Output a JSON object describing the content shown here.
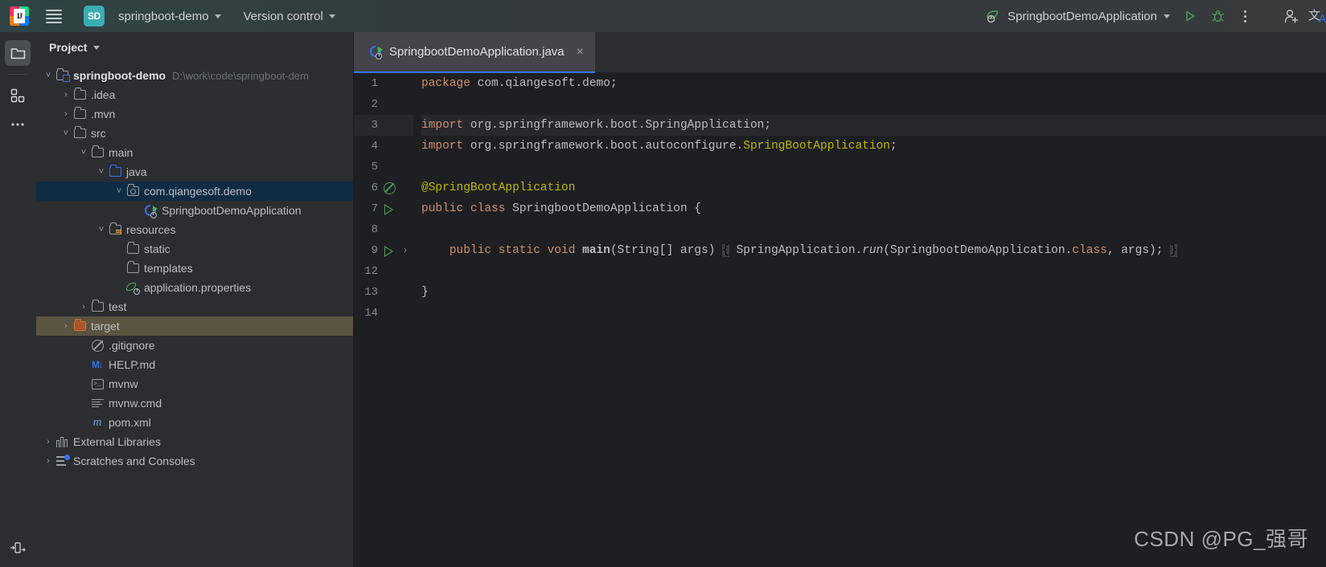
{
  "titlebar": {
    "app_icon": "intellij-idea-logo",
    "menu_icon": "hamburger-menu-icon",
    "project_badge": "SD",
    "project_name": "springboot-demo",
    "version_control": "Version control",
    "run_config": "SpringbootDemoApplication",
    "run_icon": "run-play-icon",
    "debug_icon": "debug-bug-icon",
    "more_icon": "more-actions-kebab-icon",
    "account_icon": "add-account-icon",
    "translate_icon": "translate-icon"
  },
  "rail": {
    "project_icon": "project-folder-icon",
    "structure_icon": "structure-icon",
    "more_icon": "more-tool-windows-icon",
    "bottom_icon": "layout-settings-icon"
  },
  "project_panel": {
    "title": "Project",
    "title_chevron": "chevron-down-icon",
    "tree": [
      {
        "label": "springboot-demo",
        "sublabel": "D:\\work\\code\\springboot-dem",
        "icon": "module-folder-icon",
        "indent": 0,
        "arrow": "down",
        "bold": true,
        "state": "none"
      },
      {
        "label": ".idea",
        "sublabel": "",
        "icon": "folder-icon",
        "indent": 1,
        "arrow": "right",
        "bold": false,
        "state": "none"
      },
      {
        "label": ".mvn",
        "sublabel": "",
        "icon": "folder-icon",
        "indent": 1,
        "arrow": "right",
        "bold": false,
        "state": "none"
      },
      {
        "label": "src",
        "sublabel": "",
        "icon": "folder-icon",
        "indent": 1,
        "arrow": "down",
        "bold": false,
        "state": "none"
      },
      {
        "label": "main",
        "sublabel": "",
        "icon": "folder-icon",
        "indent": 2,
        "arrow": "down",
        "bold": false,
        "state": "none"
      },
      {
        "label": "java",
        "sublabel": "",
        "icon": "source-folder-icon",
        "indent": 3,
        "arrow": "down",
        "bold": false,
        "state": "none"
      },
      {
        "label": "com.qiangesoft.demo",
        "sublabel": "",
        "icon": "package-icon",
        "indent": 4,
        "arrow": "down",
        "bold": false,
        "state": "selected"
      },
      {
        "label": "SpringbootDemoApplication",
        "sublabel": "",
        "icon": "java-class-runnable-icon",
        "indent": 5,
        "arrow": "none",
        "bold": false,
        "state": "none"
      },
      {
        "label": "resources",
        "sublabel": "",
        "icon": "resources-folder-icon",
        "indent": 3,
        "arrow": "down",
        "bold": false,
        "state": "none"
      },
      {
        "label": "static",
        "sublabel": "",
        "icon": "folder-icon",
        "indent": 4,
        "arrow": "none",
        "bold": false,
        "state": "none"
      },
      {
        "label": "templates",
        "sublabel": "",
        "icon": "folder-icon",
        "indent": 4,
        "arrow": "none",
        "bold": false,
        "state": "none"
      },
      {
        "label": "application.properties",
        "sublabel": "",
        "icon": "spring-properties-icon",
        "indent": 4,
        "arrow": "none",
        "bold": false,
        "state": "none"
      },
      {
        "label": "test",
        "sublabel": "",
        "icon": "folder-icon",
        "indent": 2,
        "arrow": "right",
        "bold": false,
        "state": "none"
      },
      {
        "label": "target",
        "sublabel": "",
        "icon": "excluded-folder-icon",
        "indent": 1,
        "arrow": "right",
        "bold": false,
        "state": "highlighted"
      },
      {
        "label": ".gitignore",
        "sublabel": "",
        "icon": "gitignore-icon",
        "indent": 2,
        "arrow": "none",
        "bold": false,
        "state": "none"
      },
      {
        "label": "HELP.md",
        "sublabel": "",
        "icon": "markdown-icon",
        "indent": 2,
        "arrow": "none",
        "bold": false,
        "state": "none"
      },
      {
        "label": "mvnw",
        "sublabel": "",
        "icon": "shell-script-icon",
        "indent": 2,
        "arrow": "none",
        "bold": false,
        "state": "none"
      },
      {
        "label": "mvnw.cmd",
        "sublabel": "",
        "icon": "cmd-file-icon",
        "indent": 2,
        "arrow": "none",
        "bold": false,
        "state": "none"
      },
      {
        "label": "pom.xml",
        "sublabel": "",
        "icon": "maven-pom-icon",
        "indent": 2,
        "arrow": "none",
        "bold": false,
        "state": "none"
      },
      {
        "label": "External Libraries",
        "sublabel": "",
        "icon": "external-libraries-icon",
        "indent": 0,
        "arrow": "right",
        "bold": false,
        "state": "none"
      },
      {
        "label": "Scratches and Consoles",
        "sublabel": "",
        "icon": "scratches-icon",
        "indent": 0,
        "arrow": "right",
        "bold": false,
        "state": "none"
      }
    ]
  },
  "editor": {
    "tab": {
      "label": "SpringbootDemoApplication.java",
      "icon": "java-class-runnable-icon",
      "close": "×"
    },
    "lines": [
      {
        "num": "1",
        "gutter": "none",
        "fold": false,
        "highlight": false
      },
      {
        "num": "2",
        "gutter": "none",
        "fold": false,
        "highlight": false
      },
      {
        "num": "3",
        "gutter": "none",
        "fold": false,
        "highlight": true
      },
      {
        "num": "4",
        "gutter": "none",
        "fold": false,
        "highlight": false
      },
      {
        "num": "5",
        "gutter": "none",
        "fold": false,
        "highlight": false
      },
      {
        "num": "6",
        "gutter": "bean",
        "fold": false,
        "highlight": false
      },
      {
        "num": "7",
        "gutter": "run",
        "fold": false,
        "highlight": false
      },
      {
        "num": "8",
        "gutter": "none",
        "fold": false,
        "highlight": false
      },
      {
        "num": "9",
        "gutter": "run",
        "fold": true,
        "highlight": false
      },
      {
        "num": "12",
        "gutter": "none",
        "fold": false,
        "highlight": false
      },
      {
        "num": "13",
        "gutter": "none",
        "fold": false,
        "highlight": false
      },
      {
        "num": "14",
        "gutter": "none",
        "fold": false,
        "highlight": false
      }
    ],
    "code_text": [
      "package com.qiangesoft.demo;",
      "",
      "import org.springframework.boot.SpringApplication;",
      "import org.springframework.boot.autoconfigure.SpringBootApplication;",
      "",
      "@SpringBootApplication",
      "public class SpringbootDemoApplication {",
      "",
      "    public static void main(String[] args) { SpringApplication.run(SpringbootDemoApplication.class, args); }",
      "",
      "}",
      ""
    ]
  },
  "watermark": "CSDN @PG_强哥",
  "colors": {
    "accent_blue": "#3574f0",
    "run_green": "#499c54",
    "badge_teal": "#3aacb3",
    "selection_blue": "#0f2c44",
    "excluded_olive": "#5b5440",
    "editor_bg": "#1e1f22",
    "panel_bg": "#2b2d30"
  }
}
